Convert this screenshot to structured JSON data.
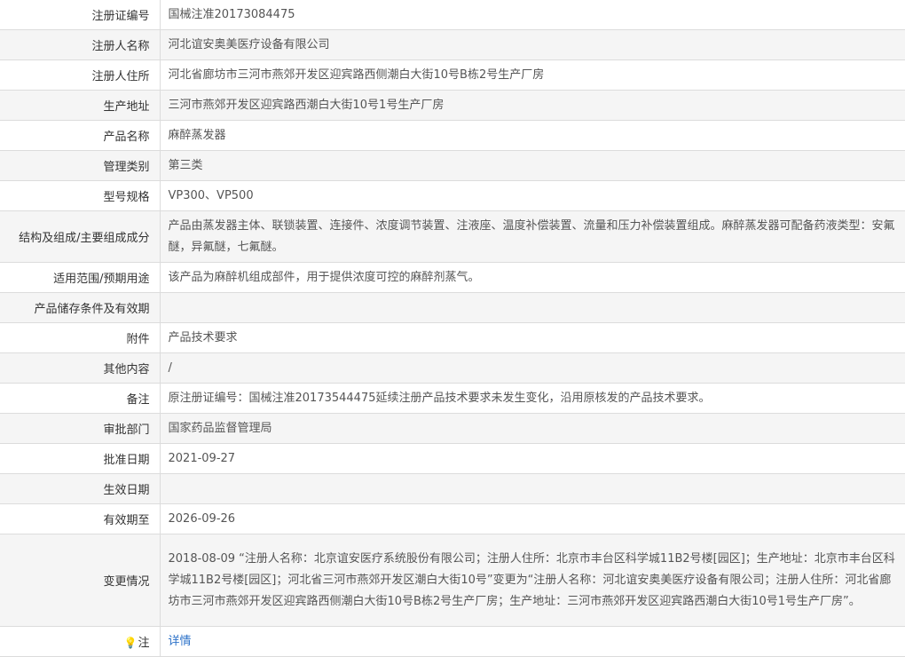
{
  "rows": [
    {
      "label": "注册证编号",
      "value": "国械注准20173084475"
    },
    {
      "label": "注册人名称",
      "value": "河北谊安奥美医疗设备有限公司"
    },
    {
      "label": "注册人住所",
      "value": "河北省廊坊市三河市燕郊开发区迎宾路西侧潮白大街10号B栋2号生产厂房"
    },
    {
      "label": "生产地址",
      "value": "三河市燕郊开发区迎宾路西潮白大街10号1号生产厂房"
    },
    {
      "label": "产品名称",
      "value": "麻醉蒸发器"
    },
    {
      "label": "管理类别",
      "value": "第三类"
    },
    {
      "label": "型号规格",
      "value": "VP300、VP500"
    },
    {
      "label": "结构及组成/主要组成成分",
      "value": "产品由蒸发器主体、联锁装置、连接件、浓度调节装置、注液座、温度补偿装置、流量和压力补偿装置组成。麻醉蒸发器可配备药液类型：安氟醚，异氟醚，七氟醚。"
    },
    {
      "label": "适用范围/预期用途",
      "value": "该产品为麻醉机组成部件，用于提供浓度可控的麻醉剂蒸气。"
    },
    {
      "label": "产品储存条件及有效期",
      "value": ""
    },
    {
      "label": "附件",
      "value": "产品技术要求"
    },
    {
      "label": "其他内容",
      "value": "/"
    },
    {
      "label": "备注",
      "value": "原注册证编号：国械注准20173544475延续注册产品技术要求未发生变化，沿用原核发的产品技术要求。"
    },
    {
      "label": "审批部门",
      "value": "国家药品监督管理局"
    },
    {
      "label": "批准日期",
      "value": "2021-09-27"
    },
    {
      "label": "生效日期",
      "value": ""
    },
    {
      "label": "有效期至",
      "value": "2026-09-26"
    },
    {
      "label": "变更情况",
      "value": "2018-08-09 “注册人名称：北京谊安医疗系统股份有限公司；注册人住所：北京市丰台区科学城11B2号楼[园区]；生产地址：北京市丰台区科学城11B2号楼[园区]；河北省三河市燕郊开发区潮白大街10号”变更为“注册人名称：河北谊安奥美医疗设备有限公司；注册人住所：河北省廊坊市三河市燕郊开发区迎宾路西侧潮白大街10号B栋2号生产厂房；生产地址：三河市燕郊开发区迎宾路西潮白大街10号1号生产厂房”。"
    }
  ],
  "note": {
    "icon": "lightbulb-icon",
    "label": "注",
    "link_text": "详情",
    "link_color": "#2b71c8"
  }
}
